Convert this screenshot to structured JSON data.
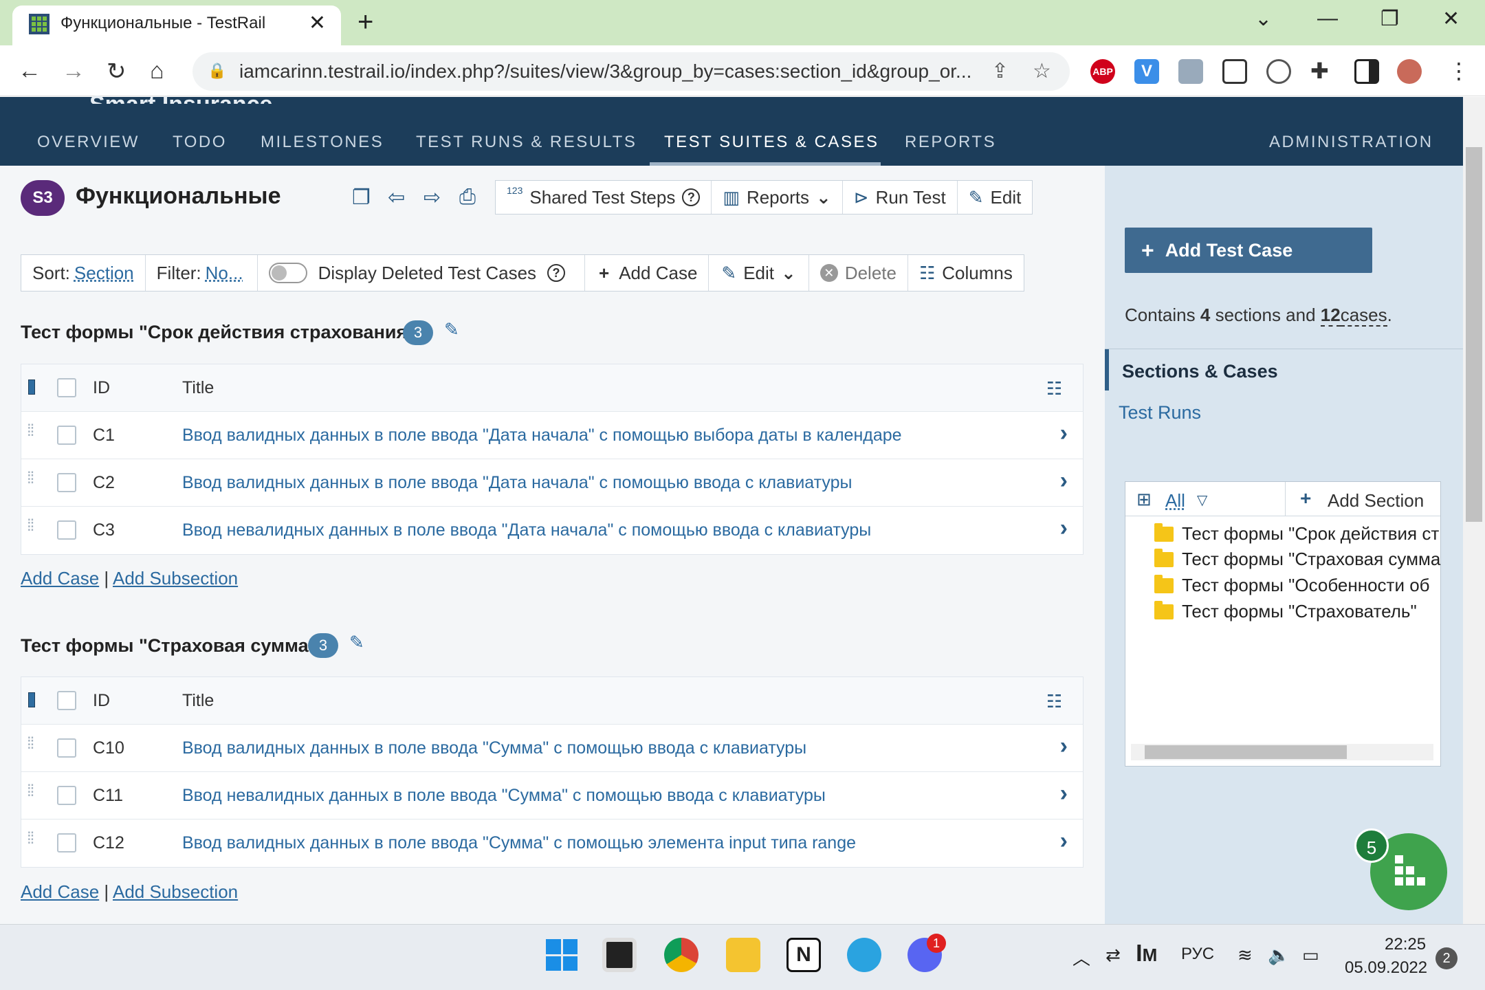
{
  "browser": {
    "tab_title": "Функциональные - TestRail",
    "url": "iamcarinn.testrail.io/index.php?/suites/view/3&group_by=cases:section_id&group_or..."
  },
  "app": {
    "logo_text": "Smart Insurance",
    "nav": [
      "OVERVIEW",
      "TODO",
      "MILESTONES",
      "TEST RUNS & RESULTS",
      "TEST SUITES & CASES",
      "REPORTS"
    ],
    "nav_right": "ADMINISTRATION",
    "active_nav": "TEST SUITES & CASES"
  },
  "suite": {
    "badge": "S3",
    "title": "Функциональные",
    "actions": {
      "shared_steps": "Shared Test Steps",
      "shared_steps_sup": "123",
      "reports": "Reports",
      "run_test": "Run Test",
      "edit": "Edit"
    }
  },
  "toolbar": {
    "sort_label": "Sort:",
    "sort_value": "Section",
    "filter_label": "Filter:",
    "filter_value": "No...",
    "display_deleted": "Display Deleted Test Cases",
    "add_case": "Add Case",
    "edit": "Edit",
    "delete": "Delete",
    "columns": "Columns"
  },
  "table_header": {
    "id": "ID",
    "title": "Title"
  },
  "sections": [
    {
      "title": "Тест формы \"Срок действия страхования\"",
      "count": "3",
      "cases": [
        {
          "id": "C1",
          "title": "Ввод валидных данных в поле ввода \"Дата начала\" с помощью выбора даты в календаре"
        },
        {
          "id": "C2",
          "title": "Ввод валидных данных в поле ввода \"Дата начала\" с помощью ввода с клавиатуры"
        },
        {
          "id": "C3",
          "title": "Ввод невалидных данных в поле ввода \"Дата начала\" с помощью ввода с клавиатуры"
        }
      ]
    },
    {
      "title": "Тест формы \"Страховая сумма\"",
      "count": "3",
      "cases": [
        {
          "id": "C10",
          "title": "Ввод валидных данных в поле ввода \"Сумма\" с помощью ввода с клавиатуры"
        },
        {
          "id": "C11",
          "title": "Ввод невалидных данных в поле ввода \"Сумма\" с помощью ввода с клавиатуры"
        },
        {
          "id": "C12",
          "title": "Ввод валидных данных в поле ввода \"Сумма\" с помощью элемента input типа range"
        }
      ]
    }
  ],
  "section_links": {
    "add_case": "Add Case",
    "separator": "|",
    "add_subsection": "Add Subsection"
  },
  "sidebar": {
    "add_test_case": "Add Test Case",
    "contains_pre": "Contains",
    "sections_count": "4",
    "sections_word": "sections and",
    "cases_count": "12",
    "cases_word": "cases",
    "period": ".",
    "sections_cases": "Sections & Cases",
    "test_runs": "Test Runs",
    "tree_filter": "All",
    "add_section": "Add Section",
    "tree": [
      "Тест формы \"Срок действия ст",
      "Тест формы \"Страховая сумма",
      "Тест формы \"Особенности об",
      "Тест формы \"Страхователь\""
    ]
  },
  "fab": {
    "badge": "5"
  },
  "taskbar": {
    "lang": "РУС",
    "time": "22:25",
    "date": "05.09.2022",
    "notifications": "2",
    "discord_badge": "1"
  },
  "colors": {
    "app_header": "#1c3d5a",
    "link": "#2b6aa0",
    "add_test_case_button": "#3f6a90",
    "fab": "#3fa34d",
    "tab_bar": "#cfe8c4"
  }
}
